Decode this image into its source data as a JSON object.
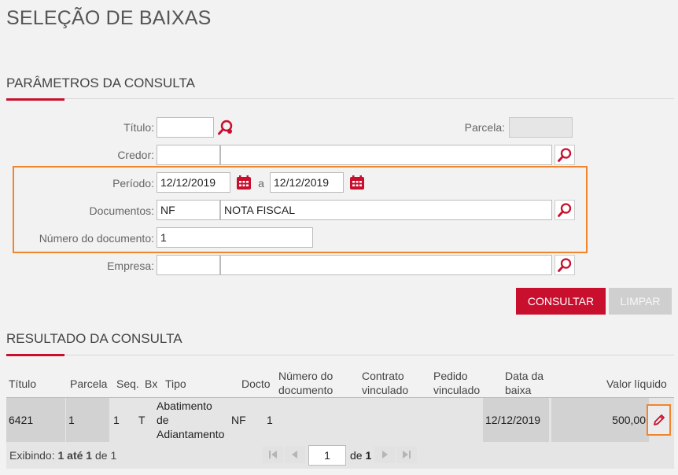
{
  "page": {
    "title": "SELEÇÃO DE BAIXAS"
  },
  "params": {
    "title": "PARÂMETROS DA CONSULTA",
    "titulo_label": "Título:",
    "titulo_value": "",
    "parcela_label": "Parcela:",
    "parcela_value": "",
    "credor_label": "Credor:",
    "credor_code": "",
    "credor_name": "",
    "periodo_label": "Período:",
    "periodo_from": "12/12/2019",
    "periodo_sep": "a",
    "periodo_to": "12/12/2019",
    "documentos_label": "Documentos:",
    "documentos_code": "NF",
    "documentos_name": "NOTA FISCAL",
    "numero_label": "Número do documento:",
    "numero_value": "1",
    "empresa_label": "Empresa:",
    "empresa_code": "",
    "empresa_name": ""
  },
  "actions": {
    "consultar": "CONSULTAR",
    "limpar": "LIMPAR"
  },
  "results": {
    "title": "RESULTADO DA CONSULTA",
    "columns": {
      "titulo": "Título",
      "parcela": "Parcela",
      "seq": "Seq.",
      "bx": "Bx",
      "tipo": "Tipo",
      "docto": "Docto",
      "numero_l1": "Número do",
      "numero_l2": "documento",
      "contrato_l1": "Contrato",
      "contrato_l2": "vinculado",
      "pedido_l1": "Pedido",
      "pedido_l2": "vinculado",
      "data_l1": "Data da",
      "data_l2": "baixa",
      "valor": "Valor líquido"
    },
    "rows": [
      {
        "titulo": "6421",
        "parcela": "1",
        "seq": "1",
        "bx": "T",
        "tipo_l1": "Abatimento",
        "tipo_l2": "de",
        "tipo_l3": "Adiantamento",
        "docto": "NF",
        "numero": "1",
        "contrato": "",
        "pedido": "",
        "data": "12/12/2019",
        "valor": "500,00"
      }
    ],
    "footer": {
      "exibindo": "Exibindo:",
      "range": "1 até 1",
      "de_label": "de",
      "total": "1",
      "page": "1",
      "of_label": "de",
      "pages": "1"
    }
  },
  "colors": {
    "accent": "#c8102e",
    "highlight": "#f0852d"
  },
  "icons": {
    "search": "search-icon",
    "calendar": "calendar-icon",
    "edit": "pencil-icon"
  }
}
